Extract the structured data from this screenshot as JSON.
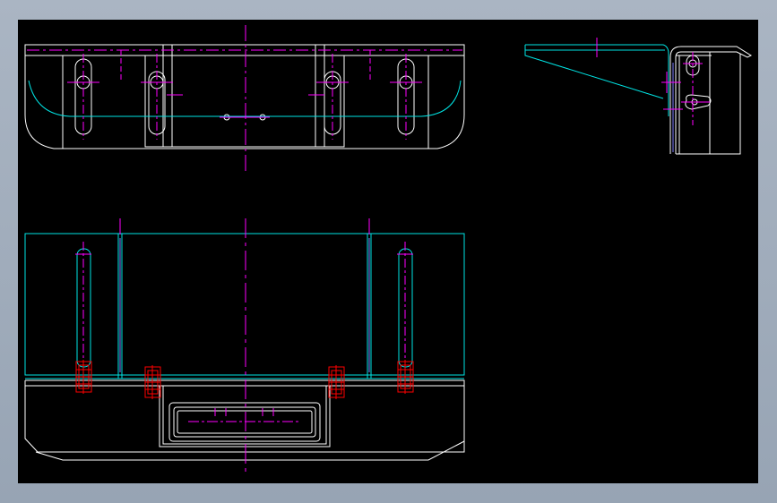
{
  "viewport": {
    "background": "#000000",
    "frame_color": "#aab5c3"
  },
  "colors": {
    "outline": "#ffffff",
    "edge": "#00e5e5",
    "centerline": "#ff00ff",
    "fastener": "#ff0000",
    "hidden": "#8080ff"
  },
  "views": [
    {
      "id": "top-view",
      "label": ""
    },
    {
      "id": "front-view",
      "label": ""
    },
    {
      "id": "side-view",
      "label": ""
    }
  ],
  "annotations": []
}
